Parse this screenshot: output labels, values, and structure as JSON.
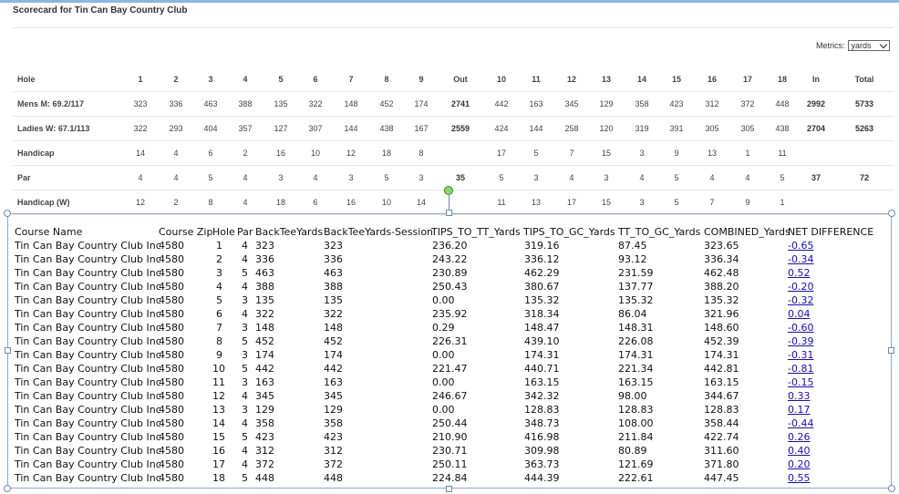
{
  "title": "Scorecard for Tin Can Bay Country Club",
  "metrics": {
    "label": "Metrics:",
    "selected": "yards"
  },
  "scorecard": {
    "rows": [
      {
        "label": "Hole",
        "cells": [
          "1",
          "2",
          "3",
          "4",
          "5",
          "6",
          "7",
          "8",
          "9",
          "Out",
          "10",
          "11",
          "12",
          "13",
          "14",
          "15",
          "16",
          "17",
          "18",
          "In",
          "Total"
        ]
      },
      {
        "label": "Mens M: 69.2/117",
        "cells": [
          "323",
          "336",
          "463",
          "388",
          "135",
          "322",
          "148",
          "452",
          "174",
          "2741",
          "442",
          "163",
          "345",
          "129",
          "358",
          "423",
          "312",
          "372",
          "448",
          "2992",
          "5733"
        ]
      },
      {
        "label": "Ladies W: 67.1/113",
        "cells": [
          "322",
          "293",
          "404",
          "357",
          "127",
          "307",
          "144",
          "438",
          "167",
          "2559",
          "424",
          "144",
          "258",
          "120",
          "319",
          "391",
          "305",
          "305",
          "438",
          "2704",
          "5263"
        ]
      },
      {
        "label": "Handicap",
        "cells": [
          "14",
          "4",
          "6",
          "2",
          "16",
          "10",
          "12",
          "18",
          "8",
          "",
          "17",
          "5",
          "7",
          "15",
          "3",
          "9",
          "13",
          "1",
          "11",
          "",
          ""
        ]
      },
      {
        "label": "Par",
        "cells": [
          "4",
          "4",
          "5",
          "4",
          "3",
          "4",
          "3",
          "5",
          "3",
          "35",
          "5",
          "3",
          "4",
          "3",
          "4",
          "5",
          "4",
          "4",
          "5",
          "37",
          "72"
        ]
      },
      {
        "label": "Handicap (W)",
        "cells": [
          "12",
          "2",
          "8",
          "4",
          "18",
          "6",
          "16",
          "10",
          "14",
          "",
          "11",
          "13",
          "17",
          "15",
          "3",
          "5",
          "7",
          "9",
          "1",
          "",
          ""
        ]
      }
    ]
  },
  "table": {
    "headers": [
      "Course Name",
      "Course Zip",
      "Hole",
      "Par",
      "BackTeeYards",
      "BackTeeYards-Session",
      "TIPS_TO_TT_Yards",
      "TIPS_TO_GC_Yards",
      "TT_TO_GC_Yards",
      "COMBINED_Yards",
      "NET DIFFERENCE"
    ],
    "rows": [
      [
        "Tin Can Bay Country Club Inc",
        "4580",
        "1",
        "4",
        "323",
        "323",
        "236.20",
        "319.16",
        "87.45",
        "323.65",
        "-0.65"
      ],
      [
        "Tin Can Bay Country Club Inc",
        "4580",
        "2",
        "4",
        "336",
        "336",
        "243.22",
        "336.12",
        "93.12",
        "336.34",
        "-0.34"
      ],
      [
        "Tin Can Bay Country Club Inc",
        "4580",
        "3",
        "5",
        "463",
        "463",
        "230.89",
        "462.29",
        "231.59",
        "462.48",
        "0.52"
      ],
      [
        "Tin Can Bay Country Club Inc",
        "4580",
        "4",
        "4",
        "388",
        "388",
        "250.43",
        "380.67",
        "137.77",
        "388.20",
        "-0.20"
      ],
      [
        "Tin Can Bay Country Club Inc",
        "4580",
        "5",
        "3",
        "135",
        "135",
        "0.00",
        "135.32",
        "135.32",
        "135.32",
        "-0.32"
      ],
      [
        "Tin Can Bay Country Club Inc",
        "4580",
        "6",
        "4",
        "322",
        "322",
        "235.92",
        "318.34",
        "86.04",
        "321.96",
        "0.04"
      ],
      [
        "Tin Can Bay Country Club Inc",
        "4580",
        "7",
        "3",
        "148",
        "148",
        "0.29",
        "148.47",
        "148.31",
        "148.60",
        "-0.60"
      ],
      [
        "Tin Can Bay Country Club Inc",
        "4580",
        "8",
        "5",
        "452",
        "452",
        "226.31",
        "439.10",
        "226.08",
        "452.39",
        "-0.39"
      ],
      [
        "Tin Can Bay Country Club Inc",
        "4580",
        "9",
        "3",
        "174",
        "174",
        "0.00",
        "174.31",
        "174.31",
        "174.31",
        "-0.31"
      ],
      [
        "Tin Can Bay Country Club Inc",
        "4580",
        "10",
        "5",
        "442",
        "442",
        "221.47",
        "440.71",
        "221.34",
        "442.81",
        "-0.81"
      ],
      [
        "Tin Can Bay Country Club Inc",
        "4580",
        "11",
        "3",
        "163",
        "163",
        "0.00",
        "163.15",
        "163.15",
        "163.15",
        "-0.15"
      ],
      [
        "Tin Can Bay Country Club Inc",
        "4580",
        "12",
        "4",
        "345",
        "345",
        "246.67",
        "342.32",
        "98.00",
        "344.67",
        "0.33"
      ],
      [
        "Tin Can Bay Country Club Inc",
        "4580",
        "13",
        "3",
        "129",
        "129",
        "0.00",
        "128.83",
        "128.83",
        "128.83",
        "0.17"
      ],
      [
        "Tin Can Bay Country Club Inc",
        "4580",
        "14",
        "4",
        "358",
        "358",
        "250.44",
        "348.73",
        "108.00",
        "358.44",
        "-0.44"
      ],
      [
        "Tin Can Bay Country Club Inc",
        "4580",
        "15",
        "5",
        "423",
        "423",
        "210.90",
        "416.98",
        "211.84",
        "422.74",
        "0.26"
      ],
      [
        "Tin Can Bay Country Club Inc",
        "4580",
        "16",
        "4",
        "312",
        "312",
        "230.71",
        "309.98",
        "80.89",
        "311.60",
        "0.40"
      ],
      [
        "Tin Can Bay Country Club Inc",
        "4580",
        "17",
        "4",
        "372",
        "372",
        "250.11",
        "363.73",
        "121.69",
        "371.80",
        "0.20"
      ],
      [
        "Tin Can Bay Country Club Inc",
        "4580",
        "18",
        "5",
        "448",
        "448",
        "224.84",
        "444.39",
        "222.61",
        "447.45",
        "0.55"
      ]
    ]
  }
}
